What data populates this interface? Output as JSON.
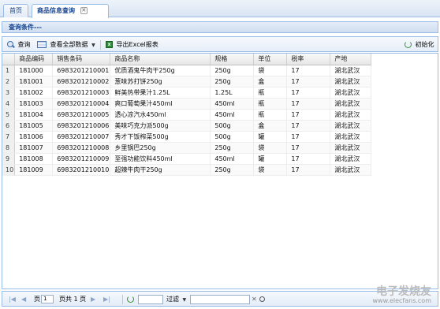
{
  "tabs": [
    {
      "label": "首页"
    },
    {
      "label": "商品信息查询"
    }
  ],
  "query_panel": {
    "title": "查询条件---"
  },
  "toolbar": {
    "query_label": "查询",
    "view_all_label": "查看全部数据",
    "export_label": "导出Excel报表",
    "reset_label": "初始化"
  },
  "grid": {
    "columns": [
      "",
      "商品编码",
      "销售条码",
      "商品名称",
      "规格",
      "单位",
      "税率",
      "产地"
    ],
    "rows": [
      [
        "1",
        "181000",
        "6983201210001",
        "优质酒鬼牛肉干250g",
        "250g",
        "袋",
        "17",
        "湖北武汉"
      ],
      [
        "2",
        "181001",
        "6983201210002",
        "葱味苏打饼250g",
        "250g",
        "盒",
        "17",
        "湖北武汉"
      ],
      [
        "3",
        "181002",
        "6983201210003",
        "鲜美热带果汁1.25L",
        "1.25L",
        "瓶",
        "17",
        "湖北武汉"
      ],
      [
        "4",
        "181003",
        "6983201210004",
        "爽口葡萄果汁450ml",
        "450ml",
        "瓶",
        "17",
        "湖北武汉"
      ],
      [
        "5",
        "181004",
        "6983201210005",
        "透心凉汽水450ml",
        "450ml",
        "瓶",
        "17",
        "湖北武汉"
      ],
      [
        "6",
        "181005",
        "6983201210006",
        "美味巧克力派500g",
        "500g",
        "盒",
        "17",
        "湖北武汉"
      ],
      [
        "7",
        "181006",
        "6983201210007",
        "秀才下饭榨菜500g",
        "500g",
        "罐",
        "17",
        "湖北武汉"
      ],
      [
        "8",
        "181007",
        "6983201210008",
        "乡里锅巴250g",
        "250g",
        "袋",
        "17",
        "湖北武汉"
      ],
      [
        "9",
        "181008",
        "6983201210009",
        "至强功能饮料450ml",
        "450ml",
        "罐",
        "17",
        "湖北武汉"
      ],
      [
        "10",
        "181009",
        "6983201210010",
        "超辣牛肉干250g",
        "250g",
        "袋",
        "17",
        "湖北武汉"
      ]
    ]
  },
  "pager": {
    "page_prefix": "页",
    "page_value": "1",
    "page_total": "页共 1 页",
    "filter_label": "过滤"
  },
  "watermark": {
    "line1": "电子发烧友",
    "line2": "www.elecfans.com"
  },
  "colors": {
    "accent": "#15428b",
    "border": "#99bbe8"
  }
}
